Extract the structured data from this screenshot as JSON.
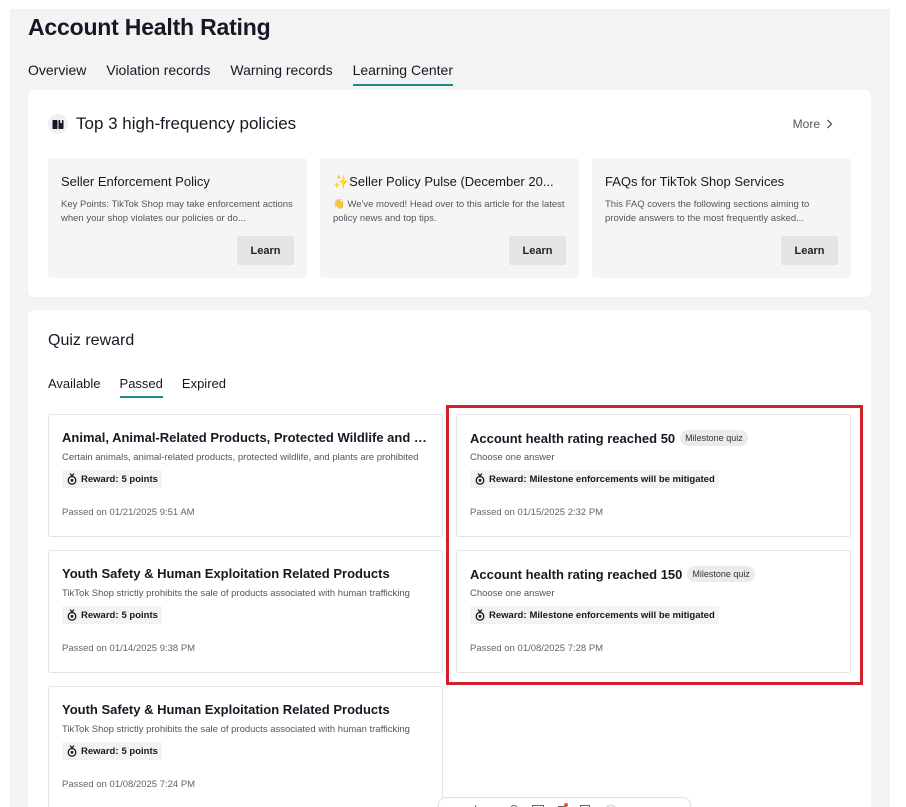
{
  "page": {
    "title": "Account Health Rating"
  },
  "tabs": [
    {
      "label": "Overview",
      "active": false
    },
    {
      "label": "Violation records",
      "active": false
    },
    {
      "label": "Warning records",
      "active": false
    },
    {
      "label": "Learning Center",
      "active": true
    }
  ],
  "policies": {
    "title": "Top 3 high-frequency policies",
    "more_label": "More",
    "items": [
      {
        "title": "Seller Enforcement Policy",
        "description": "Key Points: TikTok Shop may take enforcement actions when your shop violates our policies or do...",
        "button": "Learn"
      },
      {
        "title": "✨Seller Policy Pulse (December 20...",
        "description": "👋 We've moved! Head over to this article for the latest policy news and top tips.",
        "button": "Learn"
      },
      {
        "title": "FAQs for TikTok Shop Services",
        "description": "This FAQ covers the following sections aiming to provide answers to the most frequently asked...",
        "button": "Learn"
      }
    ]
  },
  "quiz": {
    "title": "Quiz reward",
    "tabs": [
      {
        "label": "Available",
        "active": false
      },
      {
        "label": "Passed",
        "active": true
      },
      {
        "label": "Expired",
        "active": false
      }
    ],
    "reward_prefix": "Reward:",
    "items": [
      {
        "title": "Animal, Animal-Related Products, Protected Wildlife and Plants",
        "badge": "",
        "description": "Certain animals, animal-related products, protected wildlife, and plants are prohibited",
        "reward": "5 points",
        "passed": "Passed on 01/21/2025 9:51 AM"
      },
      {
        "title": "Account health rating reached 50",
        "badge": "Milestone quiz",
        "description": "Choose one answer",
        "reward": "Milestone enforcements will be mitigated",
        "passed": "Passed on 01/15/2025 2:32 PM"
      },
      {
        "title": "Youth Safety & Human Exploitation Related Products",
        "badge": "",
        "description": "TikTok Shop strictly prohibits the sale of products associated with human trafficking",
        "reward": "5 points",
        "passed": "Passed on 01/14/2025 9:38 PM"
      },
      {
        "title": "Account health rating reached 150",
        "badge": "Milestone quiz",
        "description": "Choose one answer",
        "reward": "Milestone enforcements will be mitigated",
        "passed": "Passed on 01/08/2025 7:28 PM"
      },
      {
        "title": "Youth Safety & Human Exploitation Related Products",
        "badge": "",
        "description": "TikTok Shop strictly prohibits the sale of products associated with human trafficking",
        "reward": "5 points",
        "passed": "Passed on 01/08/2025 7:24 PM"
      }
    ]
  },
  "colors": {
    "accent_underline": "#1a8a8a",
    "highlight_border": "#d0202a",
    "page_background": "#f3f3f4"
  }
}
